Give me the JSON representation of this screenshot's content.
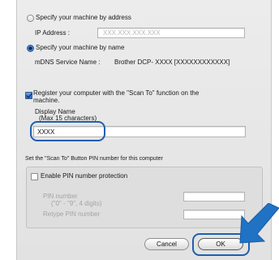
{
  "address_option": {
    "label": "Specify your machine by address",
    "ip_label": "IP Address :",
    "ip_placeholder": "XXX.XXX.XXX.XXX"
  },
  "name_option": {
    "label": "Specify your machine by name",
    "mdns_label": "mDNS Service Name :",
    "mdns_value": "Brother DCP- XXXX  [XXXXXXXXXXXX]"
  },
  "register": {
    "label_line1": "Register your computer with the \"Scan To\" function on the",
    "label_line2": "machine.",
    "display_name_label": "Display Name",
    "display_name_hint": "(Max 15 characters)",
    "display_name_value": "XXXX"
  },
  "pin_section": {
    "title": "Set the \"Scan To\" Button PIN number for this computer",
    "enable_label": "Enable PIN number protection",
    "pin_label_line1": "PIN number",
    "pin_label_line2": "(\"0\" - \"9\", 4 digits)",
    "retype_label": "Retype PIN number"
  },
  "buttons": {
    "cancel": "Cancel",
    "ok": "OK"
  },
  "colors": {
    "callout": "#1f5fb0",
    "arrow": "#1f72c4"
  },
  "icons": [
    "radio-address",
    "radio-name",
    "register-checkbox",
    "pin-checkbox",
    "pointer-arrow-icon"
  ]
}
